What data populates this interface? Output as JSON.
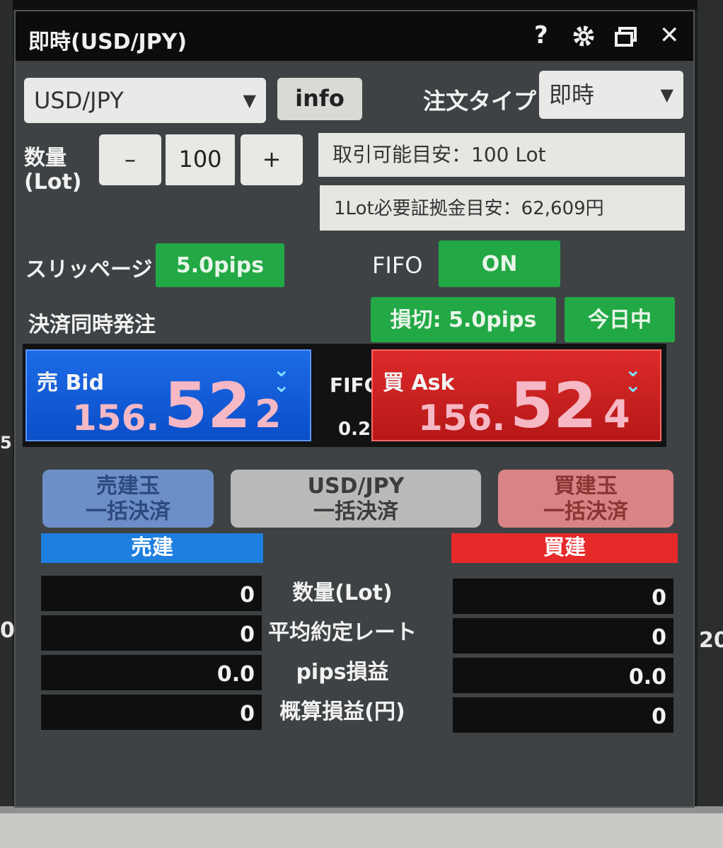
{
  "window": {
    "title": "即時(USD/JPY)",
    "icons": {
      "help": "?",
      "settings": "gear-icon",
      "restore": "window-restore-icon",
      "close": "✕"
    }
  },
  "order": {
    "pair_select": {
      "value": "USD/JPY"
    },
    "info_label": "info",
    "order_type_label": "注文タイプ",
    "order_type_select": {
      "value": "即時"
    },
    "quantity_label_line1": "数量",
    "quantity_label_line2": "(Lot)",
    "minus": "–",
    "quantity": "100",
    "plus": "+",
    "tradable": "取引可能目安：100 Lot",
    "margin": "1Lot必要証拠金目安：62,609円",
    "slippage_label": "スリッページ",
    "slippage_value": "5.0pips",
    "fifo_label": "FIFO",
    "fifo_value": "ON",
    "simultaneous_label": "決済同時発注",
    "stoploss_value": "損切: 5.0pips",
    "expiry_value": "今日中"
  },
  "prices": {
    "bid": {
      "label": "売 Bid",
      "big": "156.",
      "pips": "52",
      "last": "2"
    },
    "ask": {
      "label": "買 Ask",
      "big": "156.",
      "pips": "52",
      "last": "4"
    },
    "fifo_label": "FIFO",
    "spread": "0.2"
  },
  "settle": {
    "sell": {
      "line1": "売建玉",
      "line2": "一括決済"
    },
    "pair": {
      "line1": "USD/JPY",
      "line2": "一括決済"
    },
    "buy": {
      "line1": "買建玉",
      "line2": "一括決済"
    }
  },
  "positions": {
    "sell_header": "売建",
    "buy_header": "買建",
    "rows": [
      {
        "label": "数量(Lot)",
        "sell": "0",
        "buy": "0"
      },
      {
        "label": "平均約定レート",
        "sell": "0",
        "buy": "0"
      },
      {
        "label": "pips損益",
        "sell": "0.0",
        "buy": "0.0"
      },
      {
        "label": "概算損益(円)",
        "sell": "0",
        "buy": "0"
      }
    ]
  },
  "edges": {
    "left_a": "5",
    "left_b": "0",
    "right": "20"
  },
  "colors": {
    "green": "#22a845",
    "bid": "#1d6be6",
    "ask": "#dd2a2a",
    "sell_header": "#1e7fe0",
    "buy_header": "#e62a2a"
  }
}
